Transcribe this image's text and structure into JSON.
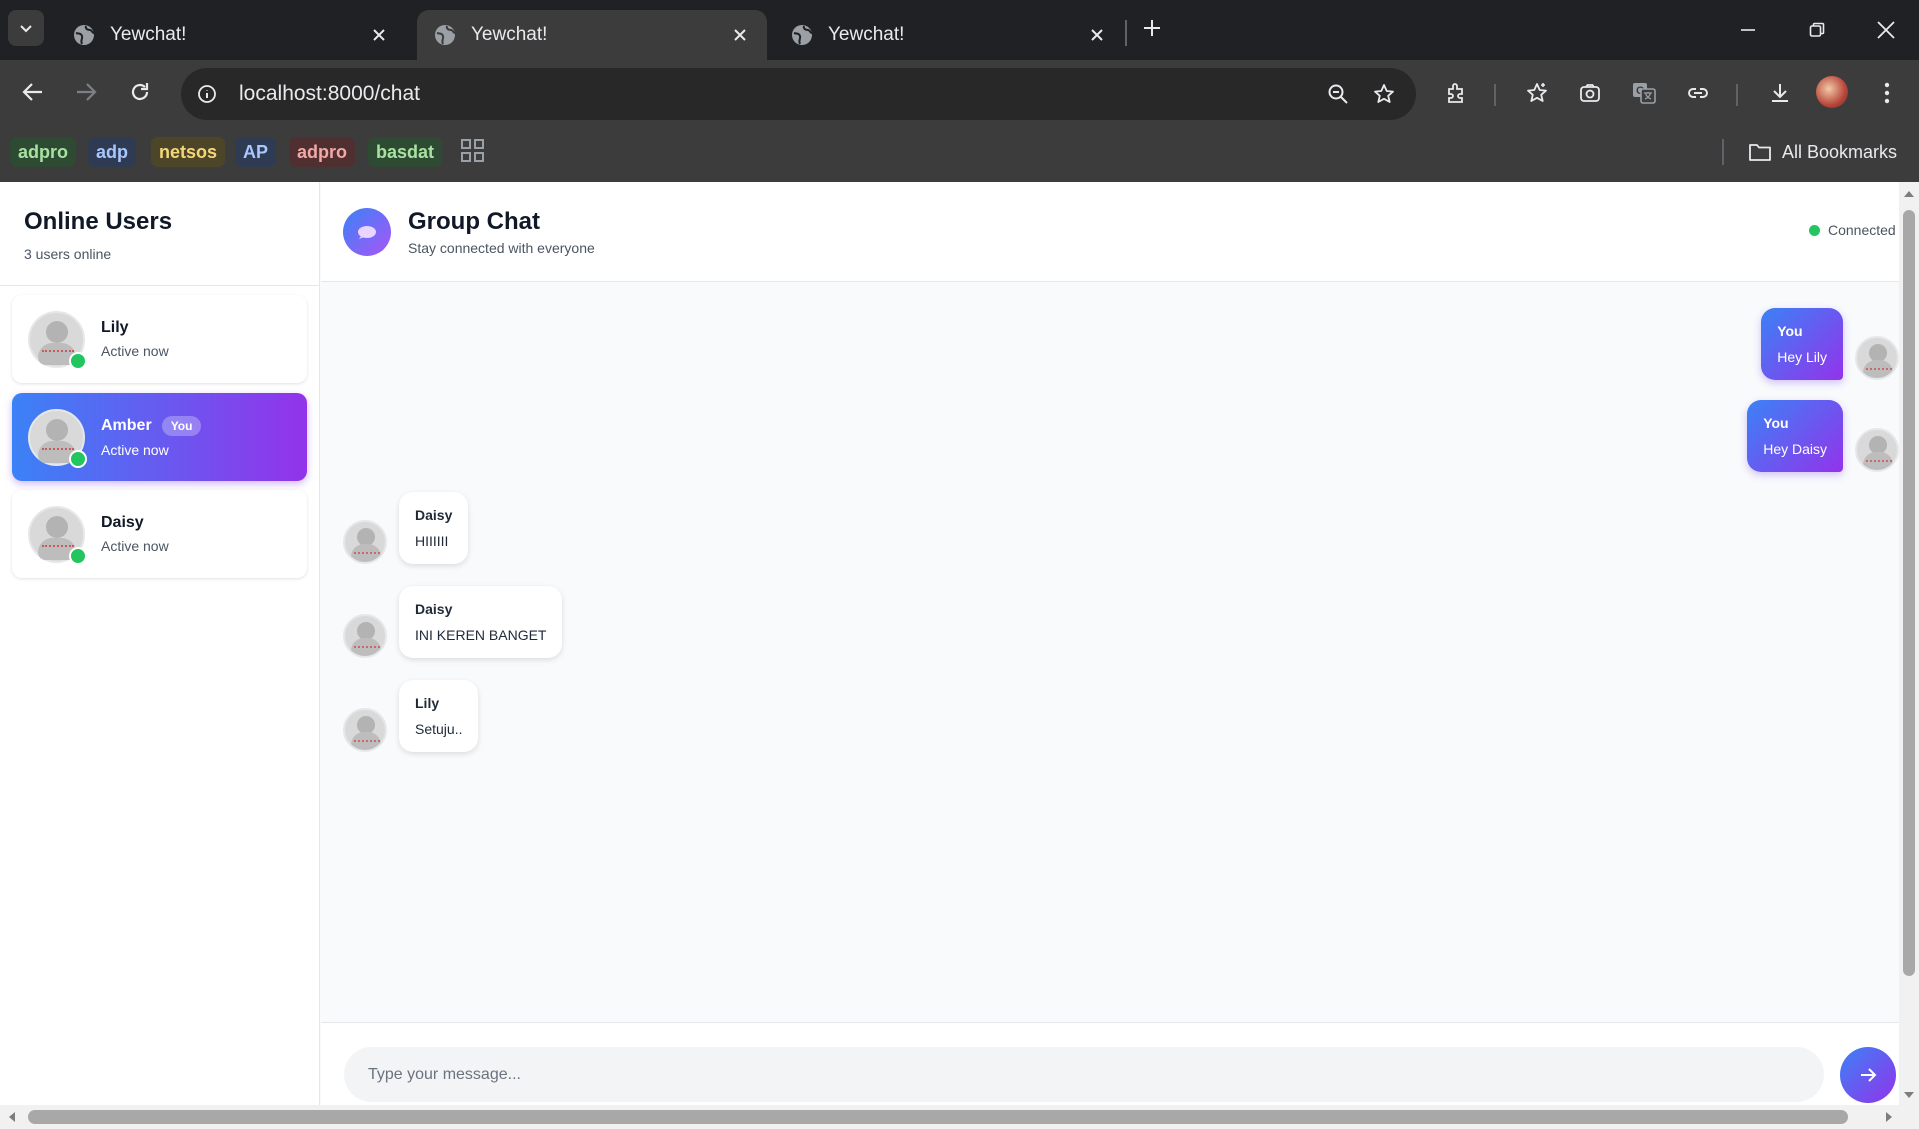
{
  "browser": {
    "tabs": [
      {
        "title": "Yewchat!",
        "active": false
      },
      {
        "title": "Yewchat!",
        "active": true
      },
      {
        "title": "Yewchat!",
        "active": false
      }
    ],
    "url": "localhost:8000/chat",
    "bookmarks": [
      {
        "label": "adpro",
        "color": "#a6e3a1",
        "bg": "#2f4a32"
      },
      {
        "label": "adp",
        "color": "#a9c7ff",
        "bg": "#2f3b52"
      },
      {
        "label": "netsos",
        "color": "#f5d77a",
        "bg": "#4d4528"
      },
      {
        "label": "AP",
        "color": "#a9c7ff",
        "bg": "#2f3b52"
      },
      {
        "label": "adpro",
        "color": "#f4a7a7",
        "bg": "#4f2f2f"
      },
      {
        "label": "basdat",
        "color": "#a6e3a1",
        "bg": "#2f4a32"
      }
    ],
    "all_bookmarks_label": "All Bookmarks"
  },
  "sidebar": {
    "title": "Online Users",
    "subtitle": "3 users online",
    "users": [
      {
        "name": "Lily",
        "status": "Active now",
        "is_you": false
      },
      {
        "name": "Amber",
        "status": "Active now",
        "is_you": true,
        "badge": "You"
      },
      {
        "name": "Daisy",
        "status": "Active now",
        "is_you": false
      }
    ]
  },
  "chat": {
    "title": "Group Chat",
    "subtitle": "Stay connected with everyone",
    "connection_status": "Connected",
    "messages": [
      {
        "from": "You",
        "text": "Hey Lily",
        "outgoing": true
      },
      {
        "from": "You",
        "text": "Hey Daisy",
        "outgoing": true
      },
      {
        "from": "Daisy",
        "text": "HIIIIII",
        "outgoing": false
      },
      {
        "from": "Daisy",
        "text": "INI KEREN BANGET",
        "outgoing": false
      },
      {
        "from": "Lily",
        "text": "Setuju..",
        "outgoing": false
      }
    ],
    "input_placeholder": "Type your message..."
  },
  "colors": {
    "accent_start": "#3b82f6",
    "accent_end": "#9333ea",
    "online": "#22c55e"
  }
}
